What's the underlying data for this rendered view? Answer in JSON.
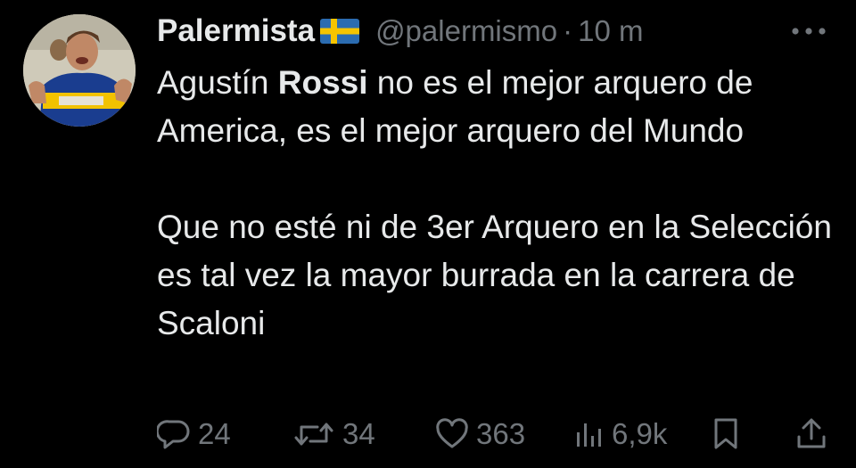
{
  "tweet": {
    "author": {
      "display_name": "Palermista",
      "flag": "sweden-flag",
      "handle": "@palermismo",
      "separator": "·",
      "time": "10 m"
    },
    "body": {
      "line1_pre": "Agustín ",
      "line1_bold": "Rossi",
      "line1_post": " no es el mejor arquero de America, es el mejor arquero del Mundo",
      "paragraph2": "Que no esté ni de 3er Arquero en la Selección es tal vez la mayor burrada en la carrera de Scaloni"
    },
    "actions": {
      "replies": "24",
      "retweets": "34",
      "likes": "363",
      "views": "6,9k"
    },
    "icons": {
      "reply": "reply-icon",
      "retweet": "retweet-icon",
      "like": "heart-icon",
      "views": "views-icon",
      "bookmark": "bookmark-icon",
      "share": "share-icon",
      "more": "more-icon"
    },
    "colors": {
      "background": "#000000",
      "text": "#e7e9ea",
      "secondary": "#71767b"
    }
  }
}
